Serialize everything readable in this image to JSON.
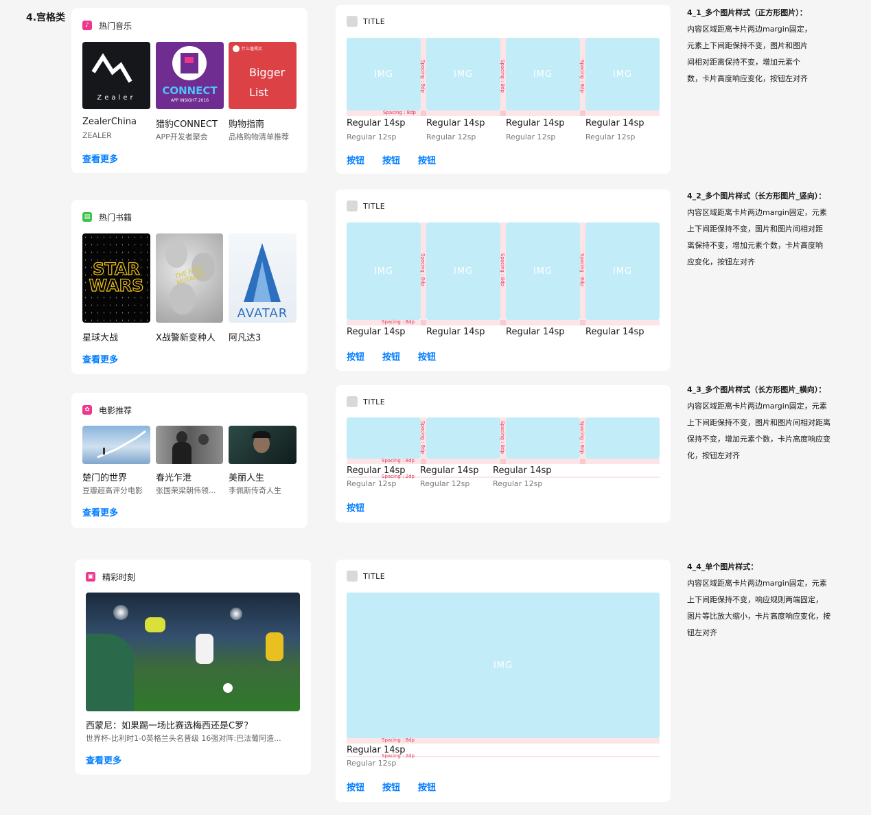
{
  "section_title": "4.宫格类",
  "music_card": {
    "title": "热门音乐",
    "items": [
      {
        "name": "ZealerChina",
        "sub": "ZEALER",
        "art": "Zealer"
      },
      {
        "name": "猎豹CONNECT",
        "sub": "APP开发者聚会",
        "art": "CONNECT",
        "art2": "APP INSIGHT 2016"
      },
      {
        "name": "购物指南",
        "sub": "品格购物清单推荐",
        "art": "Bigger List",
        "art_top": "什么值得买"
      }
    ],
    "more": "查看更多"
  },
  "book_card": {
    "title": "热门书籍",
    "items": [
      {
        "name": "星球大战",
        "art": "STAR WARS"
      },
      {
        "name": "X战警新变种人",
        "art": "THE NEW MUTANTS"
      },
      {
        "name": "阿凡达3",
        "art": "AVATAR"
      }
    ],
    "more": "查看更多"
  },
  "movie_card": {
    "title": "电影推荐",
    "items": [
      {
        "name": "楚门的世界",
        "sub": "豆瓣超高评分电影"
      },
      {
        "name": "春光乍泄",
        "sub": "张国荣梁朝伟领..."
      },
      {
        "name": "美丽人生",
        "sub": "李佩斯传奇人生"
      }
    ],
    "more": "查看更多"
  },
  "moment_card": {
    "title": "精彩时刻",
    "headline": "西蒙尼：如果踢一场比赛选梅西还是C罗？",
    "sub": "世界杯-比利时1-0英格兰头名晋级 16强对阵:巴法葡阿造...",
    "more": "查看更多"
  },
  "template": {
    "title": "TITLE",
    "img": "IMG",
    "regular14": "Regular 14sp",
    "regular12": "Regular 12sp",
    "spacing8": "Spacing : 8dp",
    "spacing2": "Spacing : 2dp",
    "button": "按钮"
  },
  "descriptions": [
    {
      "heading": "4_1_多个图片样式（正方形图片）：",
      "lines": [
        "内容区域距离卡片两边margin固定，",
        "元素上下间距保持不变，图片和图片",
        "间相对距离保持不变，增加元素个",
        "数，卡片高度响应变化，按钮左对齐"
      ]
    },
    {
      "heading": "4_2_多个图片样式（长方形图片_竖向）：",
      "lines": [
        "内容区域距离卡片两边margin固定，元素",
        "上下间距保持不变，图片和图片间相对距",
        "离保持不变，增加元素个数，卡片高度响",
        "应变化，按钮左对齐"
      ]
    },
    {
      "heading": "4_3_多个图片样式（长方形图片_横向）：",
      "lines": [
        "内容区域距离卡片两边margin固定，元素",
        "上下间距保持不变，图片和图片间相对距离",
        "保持不变，增加元素个数，卡片高度响应变",
        "化，按钮左对齐"
      ]
    },
    {
      "heading": "4_4_单个图片样式：",
      "lines": [
        "内容区域距离卡片两边margin固定，元素",
        "上下间距保持不变，响应规则两端固定，",
        "图片等比放大缩小，卡片高度响应变化，按",
        "钮左对齐"
      ]
    }
  ]
}
